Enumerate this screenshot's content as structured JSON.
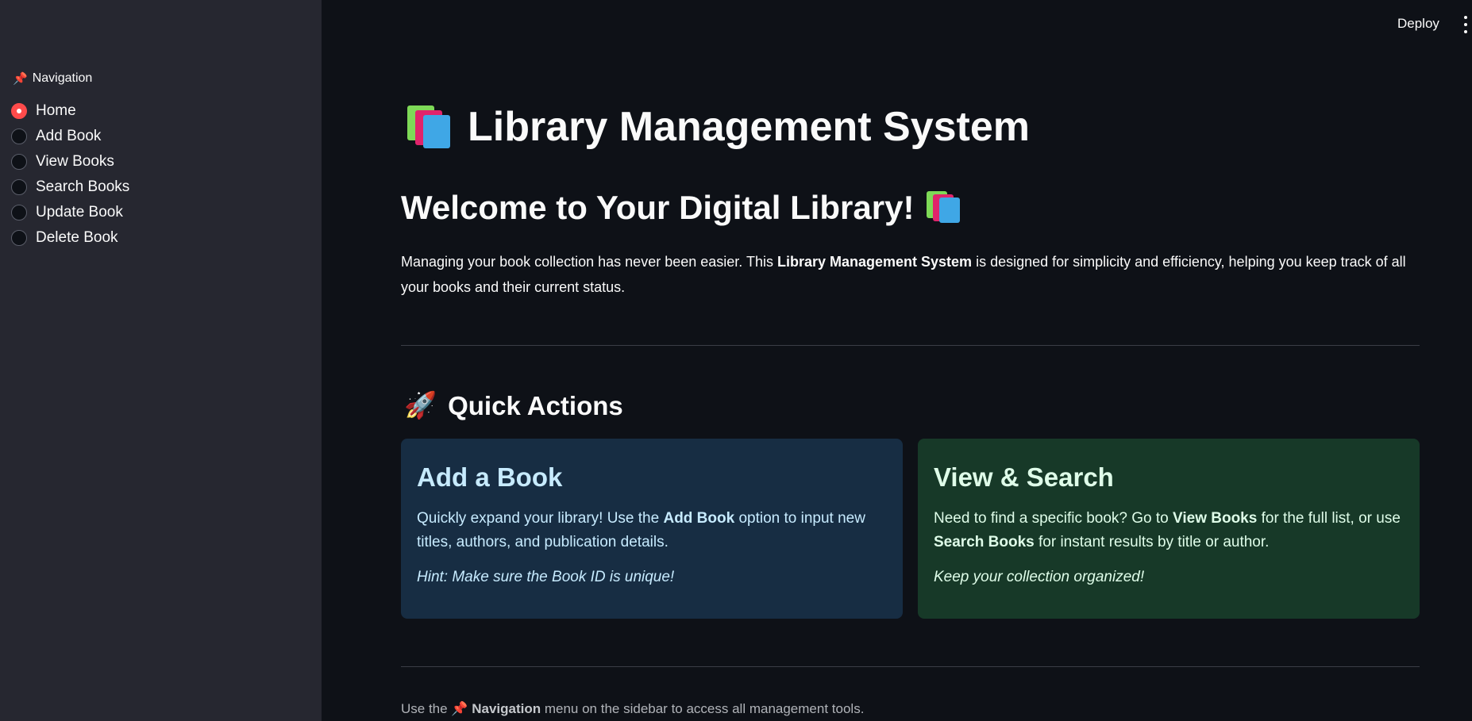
{
  "header": {
    "deploy_label": "Deploy",
    "menu_icon": "kebab-menu-icon"
  },
  "sidebar": {
    "heading_icon": "pushpin-icon",
    "heading": "Navigation",
    "selected": "Home",
    "items": [
      {
        "label": "Home",
        "selected": true
      },
      {
        "label": "Add Book",
        "selected": false
      },
      {
        "label": "View Books",
        "selected": false
      },
      {
        "label": "Search Books",
        "selected": false
      },
      {
        "label": "Update Book",
        "selected": false
      },
      {
        "label": "Delete Book",
        "selected": false
      }
    ]
  },
  "main": {
    "title_icon": "books-icon",
    "title": "Library Management System",
    "welcome": "Welcome to Your Digital Library!",
    "welcome_icon": "books-icon",
    "intro": {
      "before": "Managing your book collection has never been easier. This ",
      "bold": "Library Management System",
      "after": " is designed for simplicity and efficiency, helping you keep track of all your books and their current status."
    },
    "quick_actions": {
      "icon": "rocket-icon",
      "heading": "Quick Actions",
      "cards": [
        {
          "title": "Add a Book",
          "text_1": "Quickly expand your library! Use the ",
          "bold_1": "Add Book",
          "text_2": " option to input new titles, authors, and publication details.",
          "hint": "Hint: Make sure the Book ID is unique!",
          "color": "#172d43"
        },
        {
          "title": "View & Search",
          "text_1": "Need to find a specific book? Go to ",
          "bold_1": "View Books",
          "text_2": " for the full list, or use ",
          "bold_2": "Search Books",
          "text_3": " for instant results by title or author.",
          "hint": "Keep your collection organized!",
          "color": "#173928"
        }
      ]
    },
    "footer": {
      "before": "Use the ",
      "icon": "pushpin-icon",
      "bold": "Navigation",
      "after": " menu on the sidebar to access all management tools."
    }
  },
  "colors": {
    "background": "#0e1117",
    "sidebar": "#262730",
    "accent": "#ff4b4b"
  }
}
